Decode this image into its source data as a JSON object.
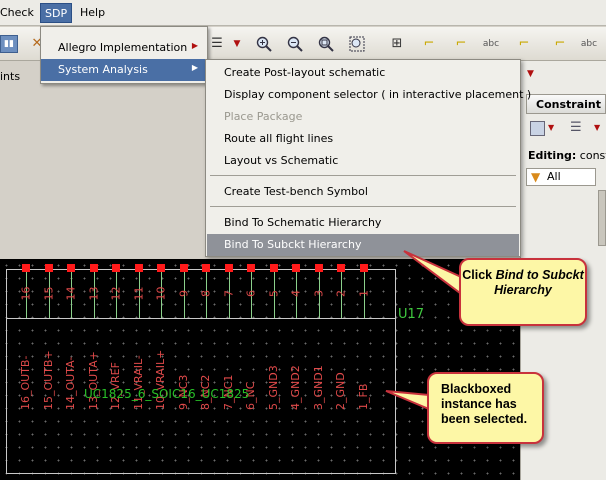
{
  "menubar": {
    "items": [
      {
        "label": "Check",
        "accel": "C"
      },
      {
        "label": "SDP",
        "accel": "S"
      },
      {
        "label": "Help",
        "accel": "H"
      }
    ]
  },
  "left_pane": {
    "label": "ints"
  },
  "sdp_menu": {
    "items": [
      {
        "label": "Allegro Implementation",
        "has_submenu": true
      },
      {
        "label": "System Analysis",
        "has_submenu": true,
        "highlighted": true
      }
    ]
  },
  "system_analysis_menu": {
    "items": [
      {
        "label": "Create Post-layout schematic",
        "enabled": true
      },
      {
        "label": "Display component selector ( in interactive placement )",
        "enabled": true
      },
      {
        "label": "Place Package",
        "enabled": false
      },
      {
        "label": "Route all flight lines",
        "enabled": true
      },
      {
        "label": "Layout vs Schematic",
        "enabled": true
      },
      {
        "label": "Create Test-bench Symbol",
        "enabled": true
      },
      {
        "label": "Bind To Schematic Hierarchy",
        "enabled": true
      },
      {
        "label": "Bind To Subckt Hierarchy",
        "enabled": true,
        "highlighted": true
      }
    ]
  },
  "right_panel": {
    "title": "Constraint M",
    "editing_label": "Editing:",
    "editing_value": "constra",
    "filter_value": "All"
  },
  "component": {
    "refdes": "U17",
    "part_name": "UC1825_6_SOIC16_UC1825",
    "pin_numbers": [
      "16",
      "15",
      "14",
      "13",
      "12",
      "11",
      "10",
      "9",
      "8",
      "7",
      "6",
      "5",
      "4",
      "3",
      "2",
      "1"
    ],
    "pin_names": [
      "16_OUTB-",
      "15_OUTB+",
      "14_OUTA-",
      "13_OUTA+",
      "12_VREF",
      "11_VRAIL-",
      "10_VRAIL+",
      "9_NC3",
      "8_NC2",
      "7_NC1",
      "6_NC",
      "5_GND3",
      "4_GND2",
      "3_GND1",
      "2_GND",
      "1_FB"
    ],
    "pad_color": "#ff1a1a",
    "pin_text_color": "#e04a4a",
    "part_text_color": "#28c028"
  },
  "callouts": {
    "bind": {
      "prefix": "Click ",
      "emphasis": "Bind to Subckt Hierarchy"
    },
    "blackbox": {
      "text": "Blackboxed instance has been selected."
    },
    "border_color": "#c8323c",
    "fill_color": "#fdf7a6"
  },
  "colors": {
    "menu_highlight": "#4a6fa5",
    "active_item_highlight": "#8f9299",
    "canvas_background": "#000000"
  }
}
